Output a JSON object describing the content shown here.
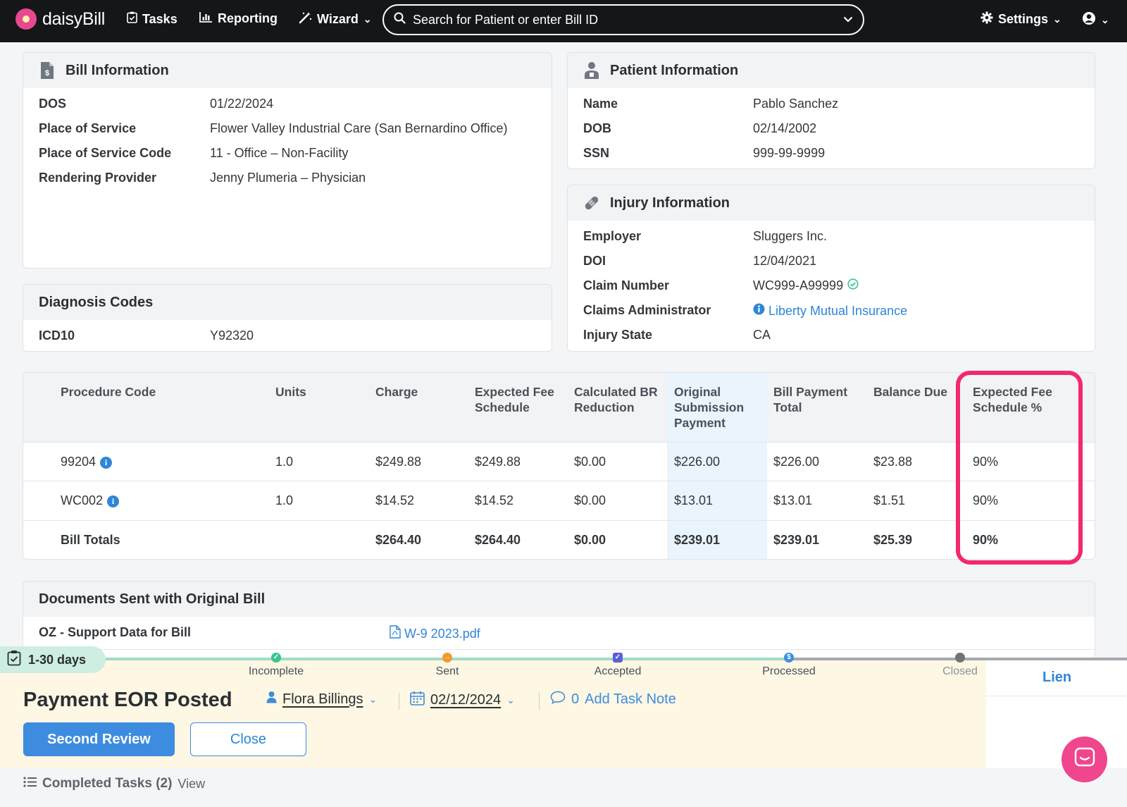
{
  "nav": {
    "brand": "daisyBill",
    "tasks": "Tasks",
    "reporting": "Reporting",
    "wizard": "Wizard",
    "search_placeholder": "Search for Patient or enter Bill ID",
    "settings": "Settings"
  },
  "bill_info": {
    "title": "Bill Information",
    "rows": [
      {
        "label": "DOS",
        "value": "01/22/2024"
      },
      {
        "label": "Place of Service",
        "value": "Flower Valley Industrial Care (San Bernardino Office)"
      },
      {
        "label": "Place of Service Code",
        "value": "11 - Office – Non-Facility"
      },
      {
        "label": "Rendering Provider",
        "value": "Jenny Plumeria – Physician"
      }
    ]
  },
  "patient_info": {
    "title": "Patient Information",
    "rows": [
      {
        "label": "Name",
        "value": "Pablo Sanchez"
      },
      {
        "label": "DOB",
        "value": "02/14/2002"
      },
      {
        "label": "SSN",
        "value": "999-99-9999"
      }
    ]
  },
  "diagnosis": {
    "title": "Diagnosis Codes",
    "label": "ICD10",
    "value": "Y92320"
  },
  "injury_info": {
    "title": "Injury Information",
    "rows": [
      {
        "label": "Employer",
        "value": "Sluggers Inc."
      },
      {
        "label": "DOI",
        "value": "12/04/2021"
      },
      {
        "label": "Claim Number",
        "value": "WC999-A99999"
      },
      {
        "label": "Claims Administrator",
        "value": "Liberty Mutual Insurance"
      },
      {
        "label": "Injury State",
        "value": "CA"
      }
    ]
  },
  "procedure_table": {
    "headers": [
      "Procedure Code",
      "Units",
      "Charge",
      "Expected Fee Schedule",
      "Calculated BR Reduction",
      "Original Submission Payment",
      "Bill Payment Total",
      "Balance Due",
      "Expected Fee Schedule %"
    ],
    "rows": [
      [
        "99204",
        "1.0",
        "$249.88",
        "$249.88",
        "$0.00",
        "$226.00",
        "$226.00",
        "$23.88",
        "90%"
      ],
      [
        "WC002",
        "1.0",
        "$14.52",
        "$14.52",
        "$0.00",
        "$13.01",
        "$13.01",
        "$1.51",
        "90%"
      ]
    ],
    "totals": [
      "Bill Totals",
      "",
      "$264.40",
      "$264.40",
      "$0.00",
      "$239.01",
      "$239.01",
      "$25.39",
      "90%"
    ]
  },
  "documents": {
    "title": "Documents Sent with Original Bill",
    "label": "OZ - Support Data for Bill",
    "file": "W-9 2023.pdf"
  },
  "task": {
    "days": "1-30 days",
    "stages": [
      "Incomplete",
      "Sent",
      "Accepted",
      "Processed",
      "Closed"
    ],
    "stage_colors": [
      "#3cc48e",
      "#f39a2a",
      "#5b5fd6",
      "#3d8ce0",
      "#6f747a"
    ],
    "title": "Payment EOR Posted",
    "assignee": "Flora Billings",
    "date": "02/12/2024",
    "note_count": "0",
    "note_label": "Add Task Note",
    "primary_button": "Second Review",
    "secondary_button": "Close",
    "lien": "Lien",
    "completed_label": "Completed Tasks (2)",
    "view_label": "View"
  },
  "colors": {
    "accent": "#2f86d6",
    "highlight": "#f3286e",
    "nav_bg": "#141618"
  }
}
